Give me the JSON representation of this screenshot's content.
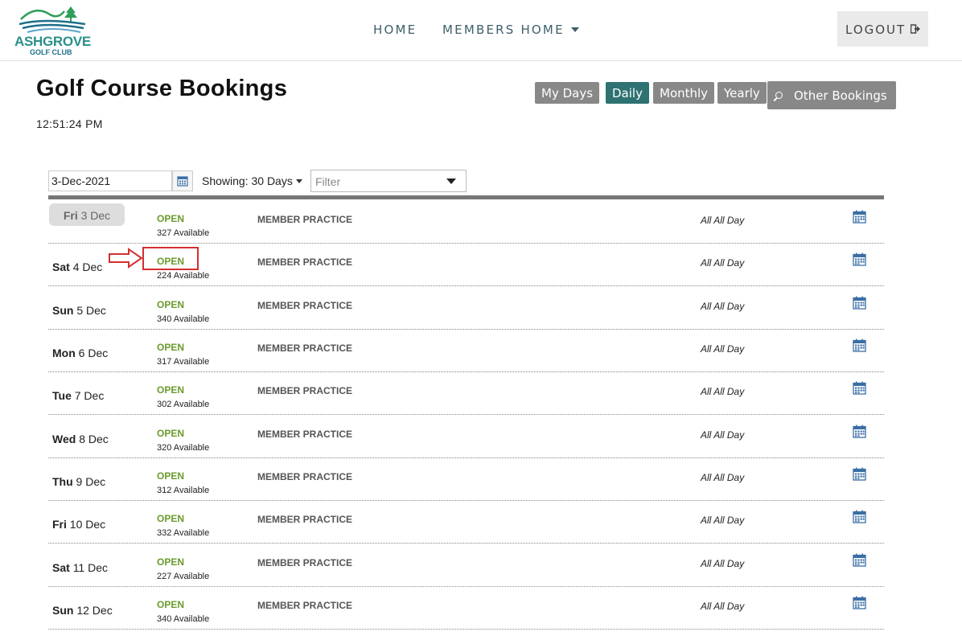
{
  "brand": {
    "name": "ASHGROVE",
    "sub": "GOLF CLUB"
  },
  "nav": {
    "home": "HOME",
    "members_home": "MEMBERS HOME",
    "logout": "LOGOUT"
  },
  "page": {
    "title": "Golf Course Bookings",
    "time": "12:51:24 PM"
  },
  "views": {
    "my_days": "My Days",
    "daily": "Daily",
    "monthly": "Monthly",
    "yearly": "Yearly",
    "other": "Other Bookings"
  },
  "controls": {
    "date": "3-Dec-2021",
    "showing": "Showing: 30 Days",
    "filter_placeholder": "Filter"
  },
  "colors": {
    "accent": "#2e7272",
    "open": "#6a9b2c",
    "button": "#888888"
  },
  "rows": [
    {
      "dow": "Fri",
      "date": "3 Dec",
      "status": "OPEN",
      "avail": "327 Available",
      "event": "MEMBER PRACTICE",
      "time": "All All Day"
    },
    {
      "dow": "Sat",
      "date": "4 Dec",
      "status": "OPEN",
      "avail": "224 Available",
      "event": "MEMBER PRACTICE",
      "time": "All All Day"
    },
    {
      "dow": "Sun",
      "date": "5 Dec",
      "status": "OPEN",
      "avail": "340 Available",
      "event": "MEMBER PRACTICE",
      "time": "All All Day"
    },
    {
      "dow": "Mon",
      "date": "6 Dec",
      "status": "OPEN",
      "avail": "317 Available",
      "event": "MEMBER PRACTICE",
      "time": "All All Day"
    },
    {
      "dow": "Tue",
      "date": "7 Dec",
      "status": "OPEN",
      "avail": "302 Available",
      "event": "MEMBER PRACTICE",
      "time": "All All Day"
    },
    {
      "dow": "Wed",
      "date": "8 Dec",
      "status": "OPEN",
      "avail": "320 Available",
      "event": "MEMBER PRACTICE",
      "time": "All All Day"
    },
    {
      "dow": "Thu",
      "date": "9 Dec",
      "status": "OPEN",
      "avail": "312 Available",
      "event": "MEMBER PRACTICE",
      "time": "All All Day"
    },
    {
      "dow": "Fri",
      "date": "10 Dec",
      "status": "OPEN",
      "avail": "332 Available",
      "event": "MEMBER PRACTICE",
      "time": "All All Day"
    },
    {
      "dow": "Sat",
      "date": "11 Dec",
      "status": "OPEN",
      "avail": "227 Available",
      "event": "MEMBER PRACTICE",
      "time": "All All Day"
    },
    {
      "dow": "Sun",
      "date": "12 Dec",
      "status": "OPEN",
      "avail": "340 Available",
      "event": "MEMBER PRACTICE",
      "time": "All All Day"
    }
  ]
}
